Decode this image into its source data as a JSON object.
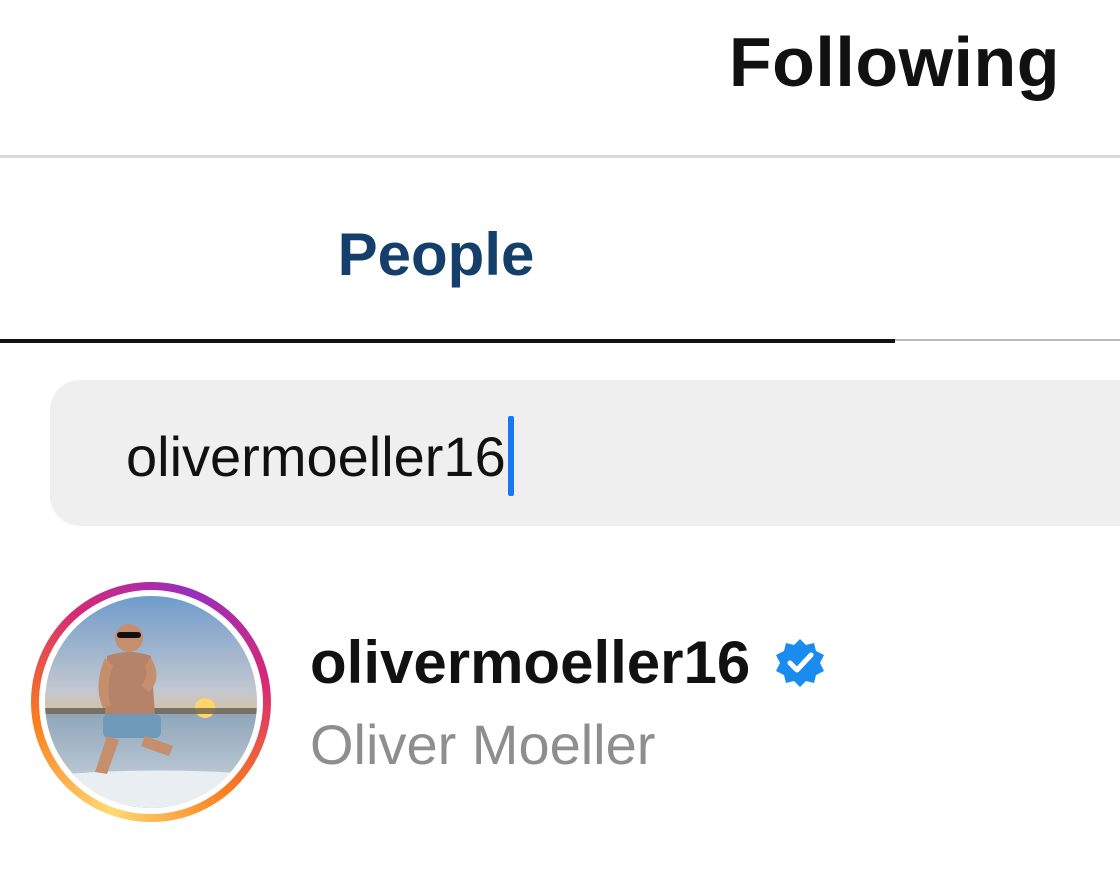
{
  "header": {
    "title": "Following"
  },
  "tabs": [
    {
      "label": "People",
      "active": true
    }
  ],
  "search": {
    "value": "olivermoeller16"
  },
  "results": [
    {
      "username": "olivermoeller16",
      "full_name": "Oliver Moeller",
      "verified": true,
      "has_story_ring": true,
      "verified_icon": "verified-badge-icon"
    }
  ],
  "colors": {
    "active_tab_text": "#143f6b",
    "caret": "#1877f2",
    "verified_badge": "#1a8cf0",
    "secondary_text": "#8e8e8e"
  }
}
